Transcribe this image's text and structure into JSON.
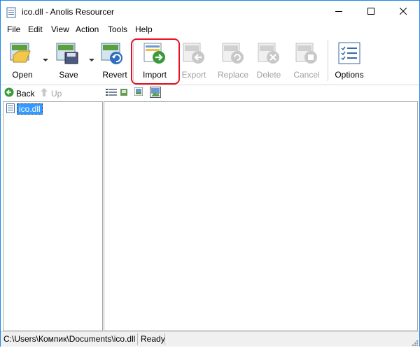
{
  "window": {
    "title": "ico.dll - Anolis Resourcer"
  },
  "menu": {
    "items": [
      "File",
      "Edit",
      "View",
      "Action",
      "Tools",
      "Help"
    ]
  },
  "toolbar": {
    "open_label": "Open",
    "save_label": "Save",
    "revert_label": "Revert",
    "import_label": "Import",
    "export_label": "Export",
    "replace_label": "Replace",
    "delete_label": "Delete",
    "cancel_label": "Cancel",
    "options_label": "Options"
  },
  "nav": {
    "back_label": "Back",
    "up_label": "Up"
  },
  "tree": {
    "items": [
      {
        "label": "ico.dll",
        "selected": true
      }
    ]
  },
  "status": {
    "path": "C:\\Users\\Компик\\Documents\\ico.dll",
    "state": "Ready"
  },
  "colors": {
    "highlight": "#e81123",
    "selection": "#3399ff",
    "border": "#1e88e5"
  }
}
